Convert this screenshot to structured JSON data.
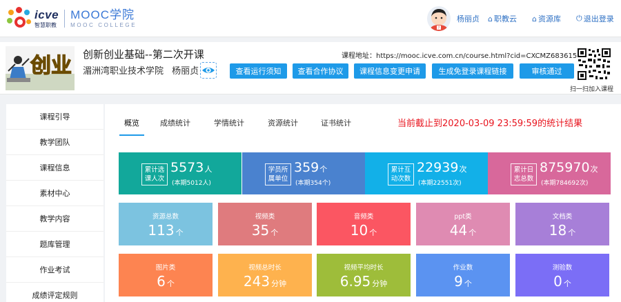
{
  "brand": {
    "icve": "icve",
    "icve_cn": "智慧职教",
    "mooc": "MOOC学院",
    "mooc_en": "MOOC COLLEGE"
  },
  "nav": {
    "user": "杨丽贞",
    "links": [
      "职教云",
      "资源库",
      "退出登录"
    ]
  },
  "course": {
    "cover_text": "创业",
    "title": "创新创业基础--第二次开课",
    "school": "湄洲湾职业技术学院",
    "teacher": "杨丽贞",
    "url": "课程地址：https://mooc.icve.com.cn/course.html?cid=CXCMZ683615",
    "buttons": [
      "查看运行须知",
      "查看合作协议",
      "课程信息变更申请",
      "生成免登录课程链接",
      "审核通过"
    ],
    "qr_caption": "扫一扫加入课程"
  },
  "sidebar": {
    "items": [
      "课程引导",
      "教学团队",
      "课程信息",
      "素材中心",
      "教学内容",
      "题库管理",
      "作业考试",
      "成绩评定规则"
    ]
  },
  "tabs": [
    "概览",
    "成绩统计",
    "学情统计",
    "资源统计",
    "证书统计"
  ],
  "stats_note": "当前截止到2020-03-09 23:59:59的统计结果",
  "summary": [
    {
      "label": "累计选课人次",
      "value": "5573",
      "unit": "人",
      "sub": "(本期5012人)",
      "color": "#12a89b"
    },
    {
      "label": "学员所属单位",
      "value": "359",
      "unit": "个",
      "sub": "(本期354个)",
      "color": "#4a82cf"
    },
    {
      "label": "累计互动次数",
      "value": "22939",
      "unit": "次",
      "sub": "(本期22551次)",
      "color": "#12b0e8"
    },
    {
      "label": "累计日志总数",
      "value": "875970",
      "unit": "次",
      "sub": "(本期784692次)",
      "color": "#d8689b"
    }
  ],
  "cards": [
    {
      "label": "资源总数",
      "value": "113",
      "unit": "个",
      "color": "#7cc3e0"
    },
    {
      "label": "视频类",
      "value": "35",
      "unit": "个",
      "color": "#df7b7e"
    },
    {
      "label": "音频类",
      "value": "10",
      "unit": "个",
      "color": "#fb5662"
    },
    {
      "label": "ppt类",
      "value": "44",
      "unit": "个",
      "color": "#df8bb2"
    },
    {
      "label": "文档类",
      "value": "18",
      "unit": "个",
      "color": "#a77fd8"
    },
    {
      "label": "图片类",
      "value": "6",
      "unit": "个",
      "color": "#fd8451"
    },
    {
      "label": "视频总时长",
      "value": "243",
      "unit": "分钟",
      "color": "#feb24e"
    },
    {
      "label": "视频平均时长",
      "value": "6.95",
      "unit": "分钟",
      "color": "#9ebd3a"
    },
    {
      "label": "作业数",
      "value": "9",
      "unit": "个",
      "color": "#5b93f1"
    },
    {
      "label": "测验数",
      "value": "0",
      "unit": "个",
      "color": "#7b6ef6"
    }
  ]
}
